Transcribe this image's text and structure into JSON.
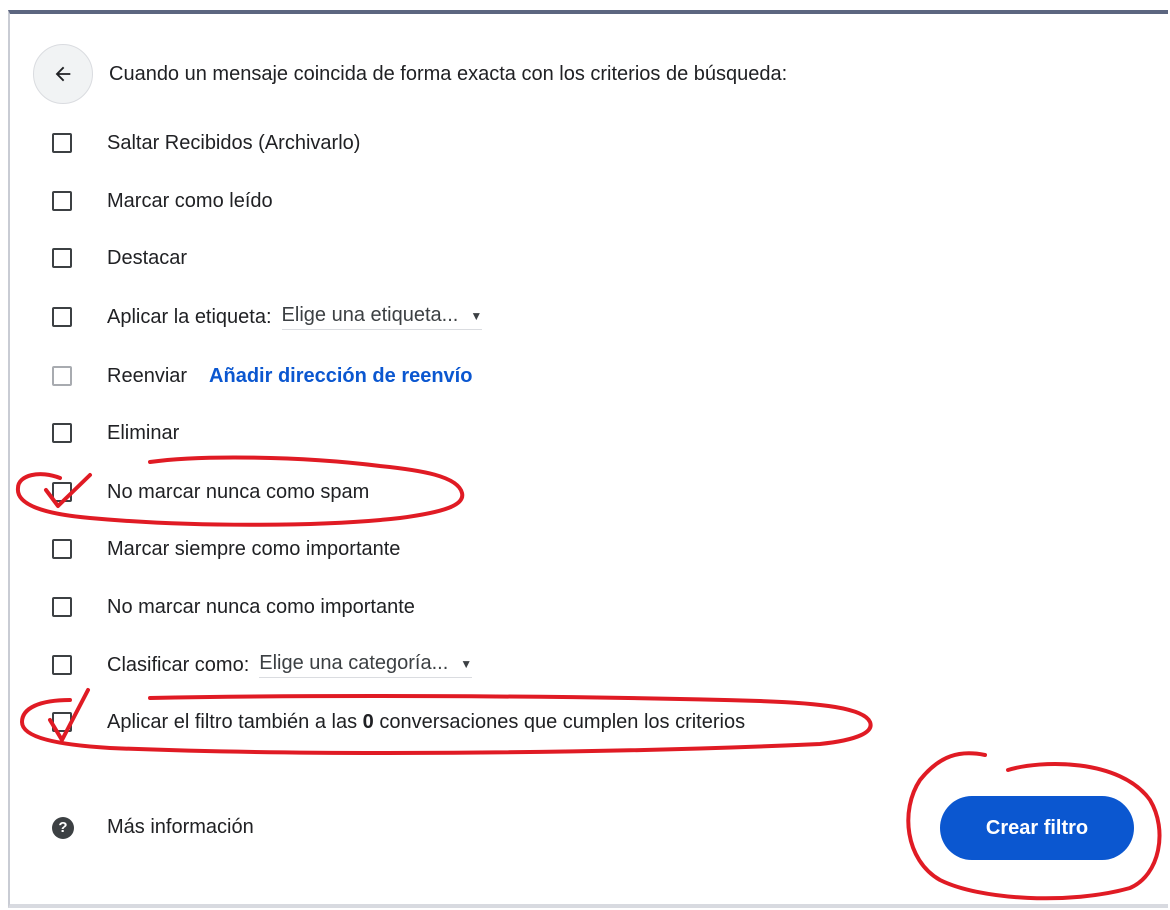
{
  "header": {
    "text": "Cuando un mensaje coincida de forma exacta con los criterios de búsqueda:"
  },
  "options": {
    "skip_inbox": {
      "label": "Saltar Recibidos (Archivarlo)",
      "checked": false
    },
    "mark_read": {
      "label": "Marcar como leído",
      "checked": false
    },
    "star": {
      "label": "Destacar",
      "checked": false
    },
    "apply_label": {
      "label": "Aplicar la etiqueta:",
      "select_value": "Elige una etiqueta...",
      "checked": false
    },
    "forward": {
      "label": "Reenviar",
      "link": "Añadir dirección de reenvío",
      "checked": false,
      "disabled": true
    },
    "delete": {
      "label": "Eliminar",
      "checked": false
    },
    "never_spam": {
      "label": "No marcar nunca como spam",
      "checked": true
    },
    "always_important": {
      "label": "Marcar siempre como importante",
      "checked": false
    },
    "never_important": {
      "label": "No marcar nunca como importante",
      "checked": false
    },
    "categorize": {
      "label": "Clasificar como:",
      "select_value": "Elige una categoría...",
      "checked": false
    },
    "apply_existing": {
      "label_before": "Aplicar el filtro también a las",
      "count": "0",
      "label_after": "conversaciones que cumplen los criterios",
      "checked": true
    }
  },
  "footer": {
    "help_label": "Más información",
    "create_button": "Crear filtro"
  },
  "colors": {
    "primary": "#0b57d0",
    "annotation": "#e01b24",
    "text": "#202124"
  }
}
